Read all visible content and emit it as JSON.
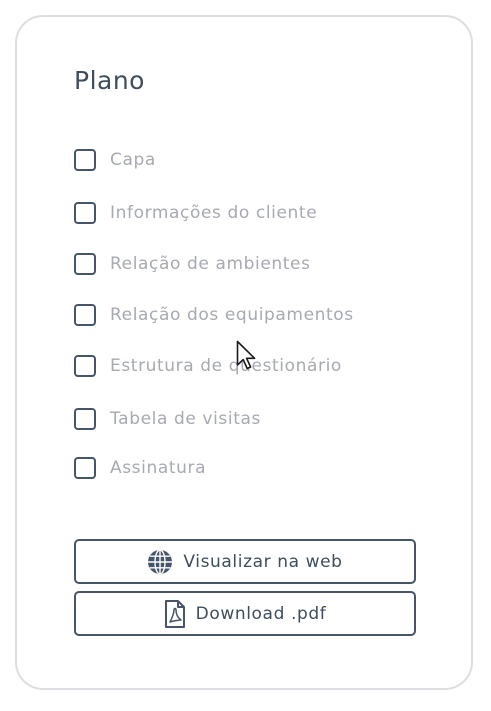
{
  "panel": {
    "title": "Plano",
    "options": [
      {
        "label": "Capa",
        "checked": false
      },
      {
        "label": "Informações do cliente",
        "checked": false
      },
      {
        "label": "Relação de ambientes",
        "checked": false
      },
      {
        "label": "Relação dos equipamentos",
        "checked": false
      },
      {
        "label": "Estrutura de questionário",
        "checked": false
      },
      {
        "label": "Tabela de visitas",
        "checked": false
      },
      {
        "label": "Assinatura",
        "checked": false
      }
    ],
    "buttons": {
      "web": {
        "label": "Visualizar na web",
        "icon": "globe-icon"
      },
      "pdf": {
        "label": "Download .pdf",
        "icon": "pdf-file-icon"
      }
    }
  },
  "colors": {
    "accent": "#46556a",
    "title": "#3e4d5e",
    "muted_text": "#a7a9b3",
    "card_border": "#dcdee2"
  }
}
